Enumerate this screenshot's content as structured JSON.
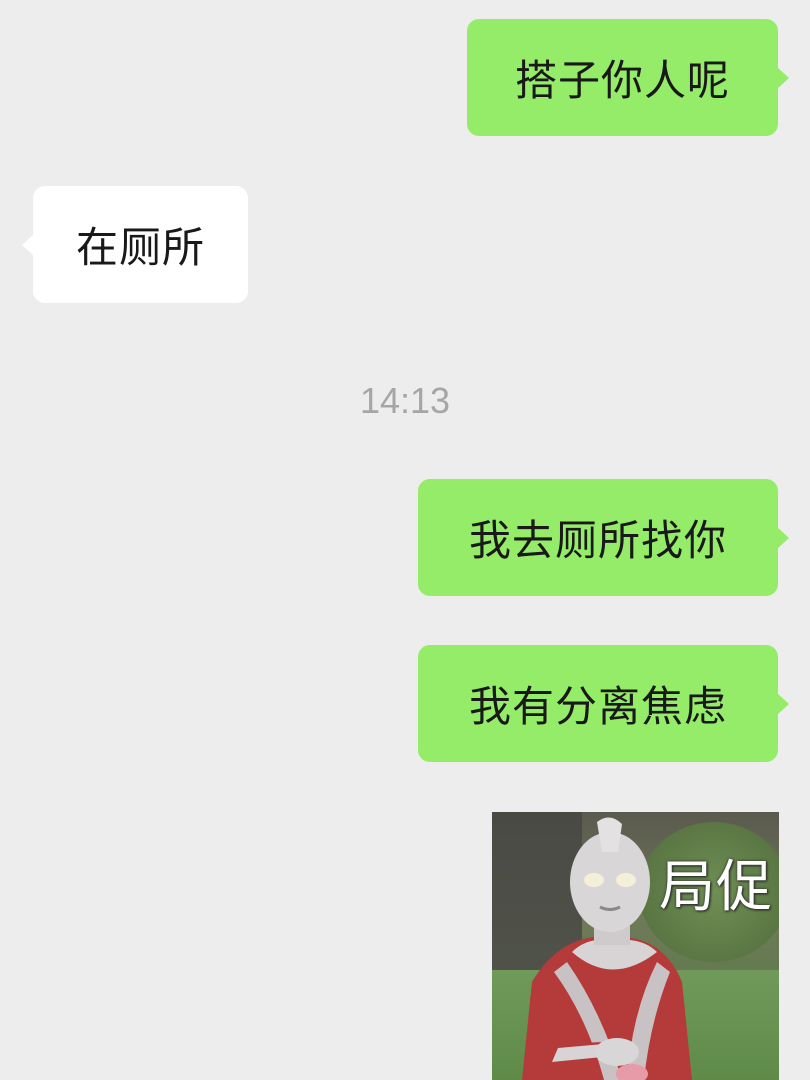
{
  "messages": [
    {
      "id": "msg1",
      "direction": "out",
      "text": "搭子你人呢"
    },
    {
      "id": "msg2",
      "direction": "in",
      "text": "在厕所"
    },
    {
      "id": "msg3",
      "direction": "out",
      "text": "我去厕所找你"
    },
    {
      "id": "msg4",
      "direction": "out",
      "text": "我有分离焦虑"
    }
  ],
  "timestamp": "14:13",
  "sticker": {
    "caption": "局促",
    "icon": "ultraman-sticker"
  },
  "colors": {
    "background": "#ededed",
    "outgoing_bubble": "#95ec69",
    "incoming_bubble": "#ffffff",
    "timestamp_text": "#a6a6a6"
  }
}
